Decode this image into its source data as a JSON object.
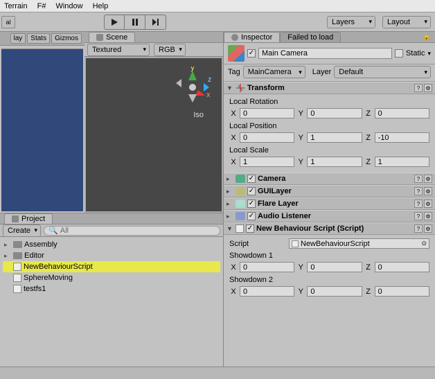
{
  "menu": [
    "Terrain",
    "F#",
    "Window",
    "Help"
  ],
  "toolbar": {
    "layers": "Layers",
    "layout": "Layout"
  },
  "game_tabs": [
    "lay",
    "Stats",
    "Gizmos"
  ],
  "scene": {
    "tab": "Scene",
    "shading": "Textured",
    "rgb": "RGB",
    "iso": "Iso"
  },
  "project": {
    "tab": "Project",
    "create": "Create",
    "search_placeholder": "All",
    "items": [
      {
        "label": "Assembly",
        "type": "folder",
        "expandable": true
      },
      {
        "label": "Editor",
        "type": "folder",
        "expandable": true
      },
      {
        "label": "NewBehaviourScript",
        "type": "script",
        "selected": true
      },
      {
        "label": "SphereMoving",
        "type": "script"
      },
      {
        "label": "testfs1",
        "type": "script"
      }
    ]
  },
  "inspector": {
    "tab": "Inspector",
    "tab2": "Failed to load",
    "go_name": "Main Camera",
    "go_enabled": true,
    "static_label": "Static",
    "tag_label": "Tag",
    "tag_value": "MainCamera",
    "layer_label": "Layer",
    "layer_value": "Default",
    "transform": {
      "title": "Transform",
      "local_rotation": "Local Rotation",
      "rot": {
        "x": "0",
        "y": "0",
        "z": "0"
      },
      "local_position": "Local Position",
      "pos": {
        "x": "0",
        "y": "1",
        "z": "-10"
      },
      "local_scale": "Local Scale",
      "scl": {
        "x": "1",
        "y": "1",
        "z": "1"
      }
    },
    "components": [
      {
        "title": "Camera",
        "checked": true
      },
      {
        "title": "GUILayer",
        "checked": true
      },
      {
        "title": "Flare Layer",
        "checked": true
      },
      {
        "title": "Audio Listener",
        "checked": true
      }
    ],
    "script_comp": {
      "title": "New Behaviour Script (Script)",
      "script_label": "Script",
      "script_value": "NewBehaviourScript",
      "prop1": "Showdown 1",
      "v1": {
        "x": "0",
        "y": "0",
        "z": "0"
      },
      "prop2": "Showdown 2",
      "v2": {
        "x": "0",
        "y": "0",
        "z": "0"
      }
    }
  },
  "labels": {
    "x": "X",
    "y": "Y",
    "z": "Z"
  }
}
